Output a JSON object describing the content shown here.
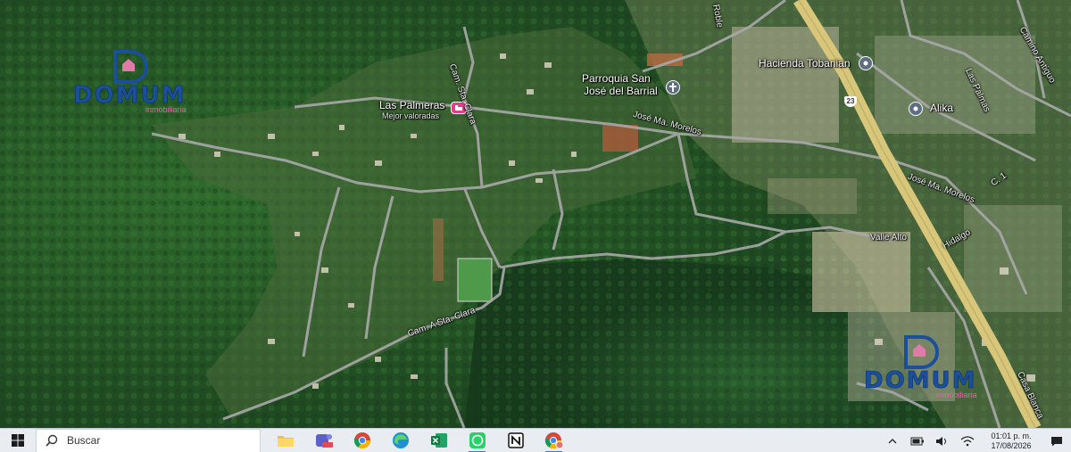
{
  "map": {
    "places": {
      "las_palmeras": "Las Palmeras",
      "las_palmeras_sub": "Mejor valoradas",
      "parroquia_1": "Parroquia San",
      "parroquia_2": "José del Barrial",
      "hacienda": "Hacienda Tobanian",
      "alika": "Alika",
      "highway_shield": "23"
    },
    "roads": {
      "cam_sta_clara_top": "Cam. Sta. Clara",
      "jose_ma_morelos": "José Ma. Morelos",
      "jose_ma_morelos_2": "José Ma. Morelos",
      "valle_alto": "Valle Alto",
      "hidalgo": "Hidalgo",
      "cam_a_sta_clara": "Cam. A Sta. Clara",
      "las_palmas": "Las Palmas",
      "camino_antiguo": "Camino Antiguo",
      "c1": "C. 1",
      "casa_blanca": "Casa Blanca",
      "roble": "Roble"
    },
    "watermark": {
      "word": "DOMUM",
      "sub": "inmobiliaria"
    }
  },
  "taskbar": {
    "search_placeholder": "Buscar",
    "apps": [
      "file-explorer",
      "teams",
      "chrome",
      "edge",
      "excel",
      "whatsapp",
      "notion",
      "chrome-profile"
    ],
    "clock_time": "01:01 p. m.",
    "clock_date": "17/08/2026",
    "colors": {
      "accent": "#3a7bd5",
      "bar": "#e9edf2"
    }
  }
}
